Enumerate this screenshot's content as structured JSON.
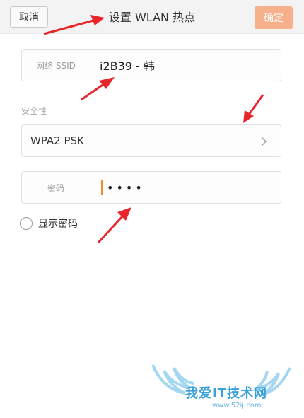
{
  "header": {
    "cancel_label": "取消",
    "title": "设置 WLAN 热点",
    "ok_label": "确定"
  },
  "form": {
    "ssid": {
      "label": "网络 SSID",
      "value": "i2B39 - 韩"
    },
    "security": {
      "section_label": "安全性",
      "selected": "WPA2 PSK"
    },
    "password": {
      "label": "密码",
      "masked_value": "••••"
    },
    "show_password_label": "显示密码"
  },
  "watermark": {
    "text": "我爱IT技术网",
    "url": "www.52ij.com"
  },
  "colors": {
    "ok_button_bg": "#f6b08c",
    "annotation_arrow": "#e8262b",
    "cursor": "#f08a2e"
  },
  "icons": {
    "security_dropdown": "chevron-right-icon",
    "show_password_toggle": "radio-icon"
  }
}
